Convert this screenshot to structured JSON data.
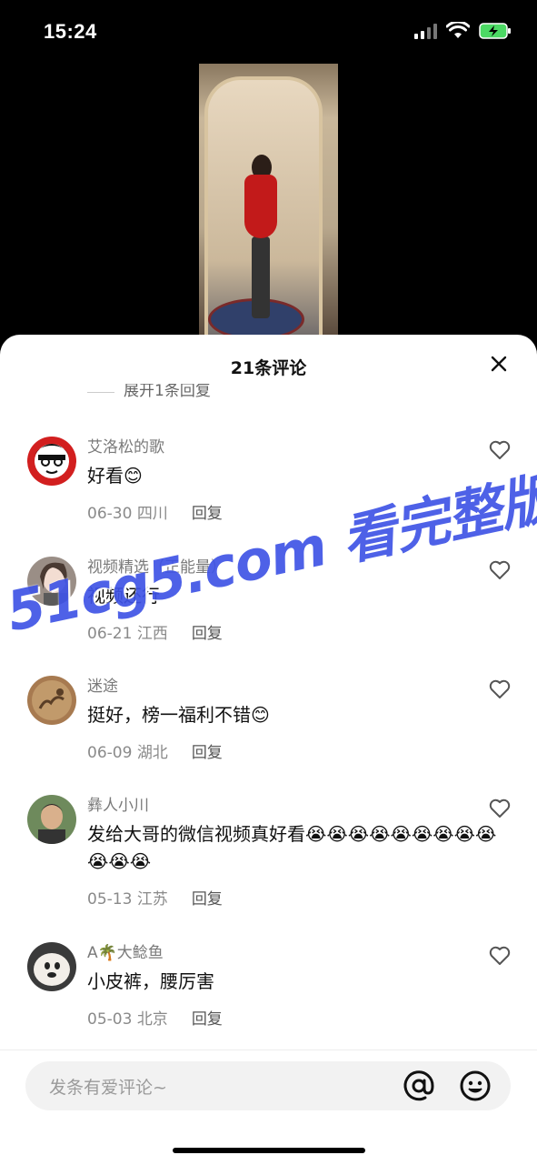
{
  "status": {
    "time": "15:24"
  },
  "sheet": {
    "title": "21条评论",
    "expand_label": "展开1条回复"
  },
  "comments": [
    {
      "name": "艾洛松的歌",
      "text": "好看😊",
      "date": "06-30",
      "location": "四川",
      "reply": "回复"
    },
    {
      "name": "视频精选（正能量）",
      "text": "视频还行",
      "date": "06-21",
      "location": "江西",
      "reply": "回复"
    },
    {
      "name": "迷途",
      "text": "挺好，榜一福利不错😊",
      "date": "06-09",
      "location": "湖北",
      "reply": "回复"
    },
    {
      "name": "彝人小川",
      "text": "发给大哥的微信视频真好看😭😭😭😭😭😭😭😭😭😭😭😭",
      "date": "05-13",
      "location": "江苏",
      "reply": "回复"
    },
    {
      "name": "A🌴大鲶鱼",
      "text": "小皮裤，腰厉害",
      "date": "05-03",
      "location": "北京",
      "reply": "回复"
    }
  ],
  "watermark": {
    "text": "51cg5.com 看完整版"
  },
  "input": {
    "placeholder": "发条有爱评论~"
  },
  "colors": {
    "watermark": "#3f54e6",
    "sheet_bg": "#ffffff",
    "screen_bg": "#000000"
  }
}
